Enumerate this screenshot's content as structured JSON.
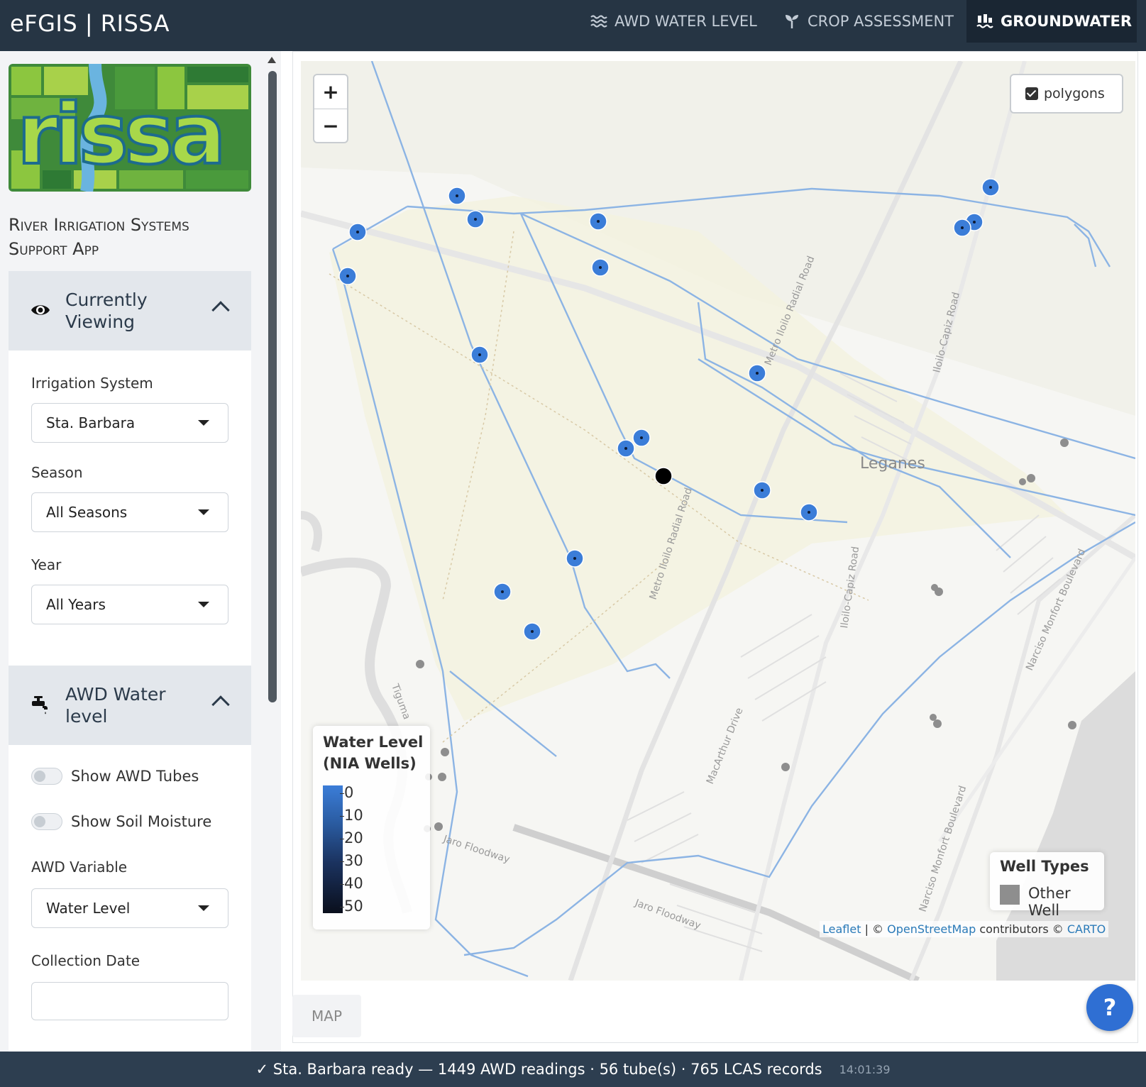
{
  "app": {
    "title": "eFGIS | RISSA"
  },
  "nav": {
    "awd": {
      "label": "AWD WATER LEVEL",
      "icon": "water-waves-icon"
    },
    "crop": {
      "label": "CROP ASSESSMENT",
      "icon": "seedling-icon"
    },
    "groundwater": {
      "label": "GROUNDWATER",
      "icon": "groundwater-icon",
      "active": true
    }
  },
  "sidebar": {
    "subtitle": "River Irrigation Systems Support App",
    "currently_viewing": {
      "title": "Currently Viewing",
      "irrigation_label": "Irrigation System",
      "irrigation_value": "Sta. Barbara",
      "season_label": "Season",
      "season_value": "All Seasons",
      "year_label": "Year",
      "year_value": "All Years"
    },
    "awd_panel": {
      "title": "AWD Water level",
      "show_tubes": "Show AWD Tubes",
      "show_soil": "Show Soil Moisture",
      "variable_label": "AWD Variable",
      "variable_value": "Water Level",
      "date_label": "Collection Date",
      "date_value": ""
    }
  },
  "map": {
    "zoom_in": "+",
    "zoom_out": "−",
    "layer_label": "polygons",
    "layer_checked": true,
    "town_label": "Leganes",
    "roads": [
      "Metro Iloilo Radial Road",
      "Iloilo-Capiz Road",
      "MacArthur Drive",
      "Narciso Monfort Boulevard",
      "Jaro Floodway",
      "Tiguma"
    ],
    "legend_water": {
      "title": "Water Level (NIA Wells)",
      "ticks": [
        "0",
        "10",
        "20",
        "30",
        "40",
        "50"
      ]
    },
    "legend_types": {
      "title": "Well Types",
      "item": "Other Well",
      "item_color": "#8e8e8e"
    },
    "attribution": {
      "leaflet": "Leaflet",
      "sep": " | © ",
      "osm": "OpenStreetMap",
      "contrib": " contributors © ",
      "carto": "CARTO"
    },
    "tab": "MAP",
    "help": "?"
  },
  "status": {
    "message": "✓ Sta. Barbara ready — 1449 AWD readings · 56 tube(s) · 765 LCAS records",
    "time": "14:01:39"
  },
  "colors": {
    "well_blue": "#3b7dd8",
    "canal": "#8cb4e4",
    "navbar": "#263544"
  }
}
